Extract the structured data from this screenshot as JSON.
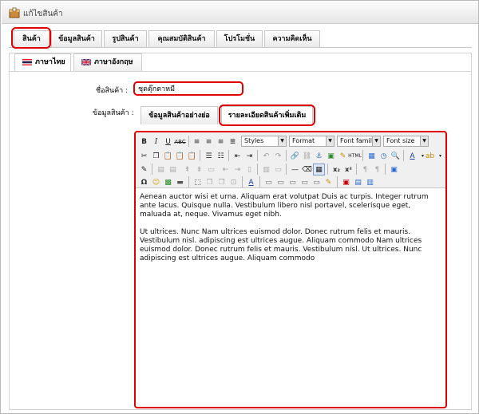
{
  "window": {
    "title": "แก้ไขสินค้า"
  },
  "tabs": [
    {
      "label": "สินค้า"
    },
    {
      "label": "ข้อมูลสินค้า"
    },
    {
      "label": "รูปสินค้า"
    },
    {
      "label": "คุณสมบัติสินค้า"
    },
    {
      "label": "โปรโมชั่น"
    },
    {
      "label": "ความคิดเห็น"
    }
  ],
  "language_tabs": [
    {
      "label": "ภาษาไทย",
      "flag": "thai-flag-icon"
    },
    {
      "label": "ภาษาอังกฤษ",
      "flag": "uk-flag-icon"
    }
  ],
  "form": {
    "name_label": "ชื่อสินค้า :",
    "name_value": "ชุดตุ๊กตาหมี",
    "info_label": "ข้อมูลสินค้า :"
  },
  "detail_tabs": [
    {
      "label": "ข้อมูลสินค้าอย่างย่อ"
    },
    {
      "label": "รายละเอียดสินค้าเพิ่มเติม"
    }
  ],
  "editor": {
    "selects": {
      "styles": "Styles",
      "format": "Format",
      "font_family": "Font family",
      "font_size": "Font size"
    },
    "paragraphs": [
      "Aenean auctor wisi et urna. Aliquam erat volutpat Duis ac turpis. Integer rutrum ante lacus. Quisque nulla. Vestibulum libero nisl portavel, scelerisque eget, maluada at, neque. Vivamus eget nibh.",
      "Ut ultrices. Nunc Nam ultrices euismod dolor. Donec rutrum felis et mauris. Vestibulum nisl. adipiscing est ultrices augue. Aliquam commodo Nam ultrices euismod dolor. Donec rutrum felis et mauris. Vestibulum nisl. Ut ultrices. Nunc adipiscing est ultrices augue. Aliquam commodo"
    ]
  },
  "colors": {
    "highlight": "#e00000",
    "border": "#c6c6c6"
  }
}
